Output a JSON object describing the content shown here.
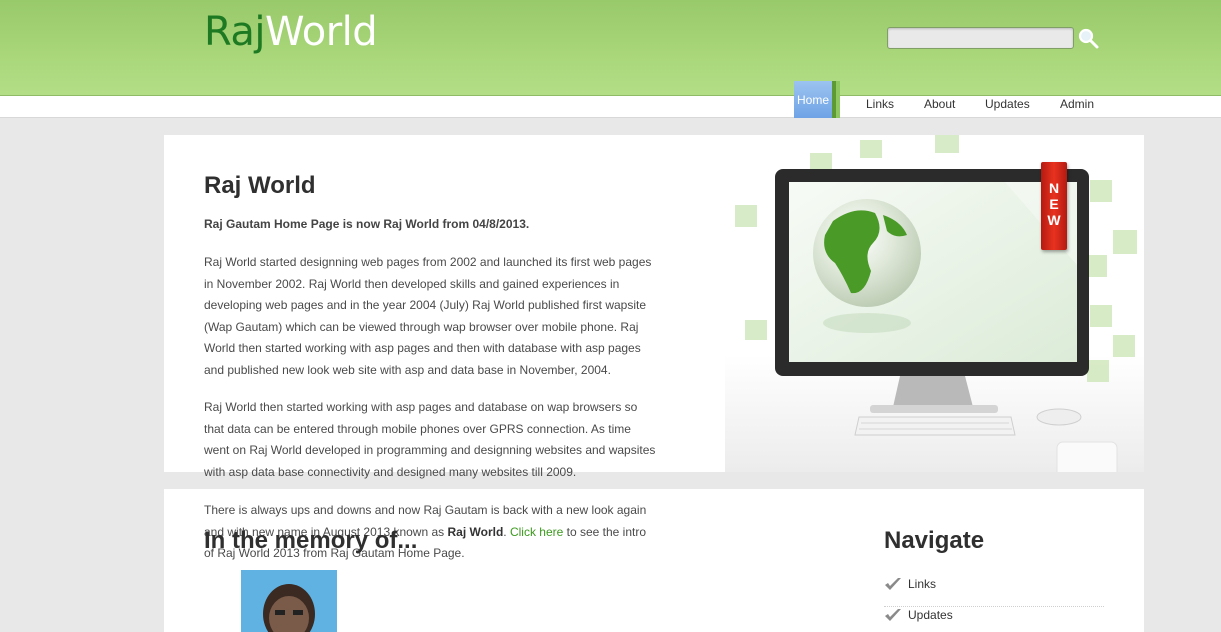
{
  "header": {
    "logo_part1": "Raj",
    "logo_part2": "World",
    "search": {
      "placeholder": ""
    }
  },
  "nav": {
    "items": [
      "Home",
      "Links",
      "About",
      "Updates",
      "Admin"
    ],
    "active": "Home"
  },
  "main": {
    "title": "Raj World",
    "intro": "Raj Gautam Home Page is now Raj World from 04/8/2013.",
    "paragraph1": "Raj World started designning web pages from 2002 and launched its first web pages in November 2002. Raj World then developed skills and gained experiences in developing web pages and in the year 2004 (July) Raj World published first wapsite (Wap Gautam) which can be viewed through wap browser over mobile phone. Raj World then started working with asp pages and then with database with asp pages and published new look web site with asp and data base in November, 2004.",
    "paragraph2": "Raj World then started working with asp pages and database on wap browsers so that data can be entered through mobile phones over GPRS connection. As time went on Raj World developed in programming and designning websites and wapsites with asp data base connectivity and designed many websites till 2009.",
    "paragraph3_before": "There is always ups and downs and now Raj Gautam is back with a new look again and with new name in August 2013 known as ",
    "paragraph3_bold": "Raj World",
    "paragraph3_link": "Click here",
    "paragraph3_after": " to see the intro of Raj World 2013 from Raj Gautam Home Page."
  },
  "banner": {
    "badge_letters": [
      "N",
      "E",
      "W"
    ]
  },
  "memory": {
    "heading": "In the memory of..."
  },
  "sidebar": {
    "heading": "Navigate",
    "links": [
      "Links",
      "Updates"
    ]
  },
  "colors": {
    "header_green": "#a9d77a",
    "logo_dark_green": "#1e7a22",
    "link_green": "#3c9a1e",
    "badge_red": "#d8281a",
    "active_tab_blue": "#7aaee9"
  }
}
